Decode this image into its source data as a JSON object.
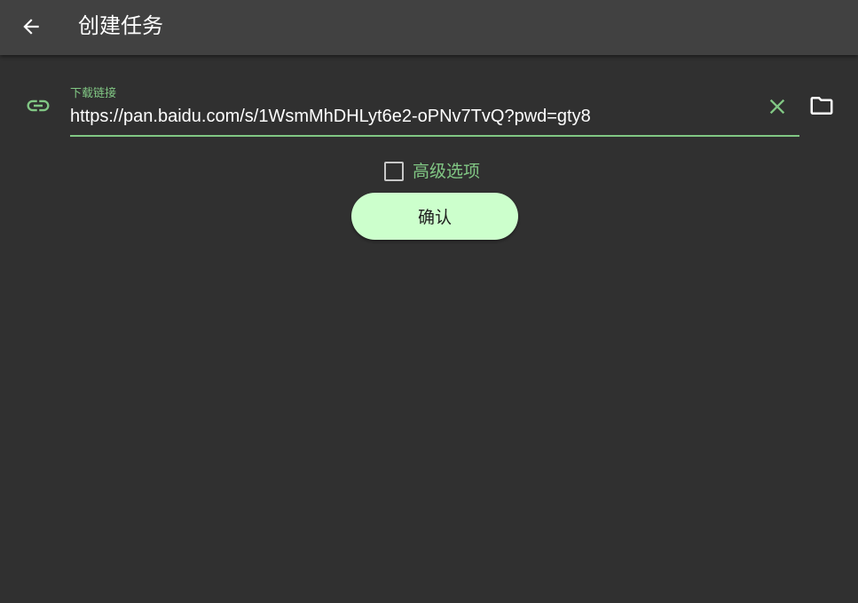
{
  "appbar": {
    "title": "创建任务",
    "back_icon": "arrow-left-icon"
  },
  "form": {
    "url_field": {
      "icon": "link-icon",
      "label": "下载链接",
      "value": "https://pan.baidu.com/s/1WsmMhDHLyt6e2-oPNv7TvQ?pwd=gty8",
      "clear_icon": "close-icon",
      "folder_icon": "folder-icon"
    },
    "advanced": {
      "label": "高级选项",
      "checked": false
    },
    "confirm_label": "确认"
  },
  "colors": {
    "background": "#303030",
    "appbar": "#414141",
    "accent": "#81c784",
    "button": "#ccffcc",
    "text": "#ffffff"
  }
}
